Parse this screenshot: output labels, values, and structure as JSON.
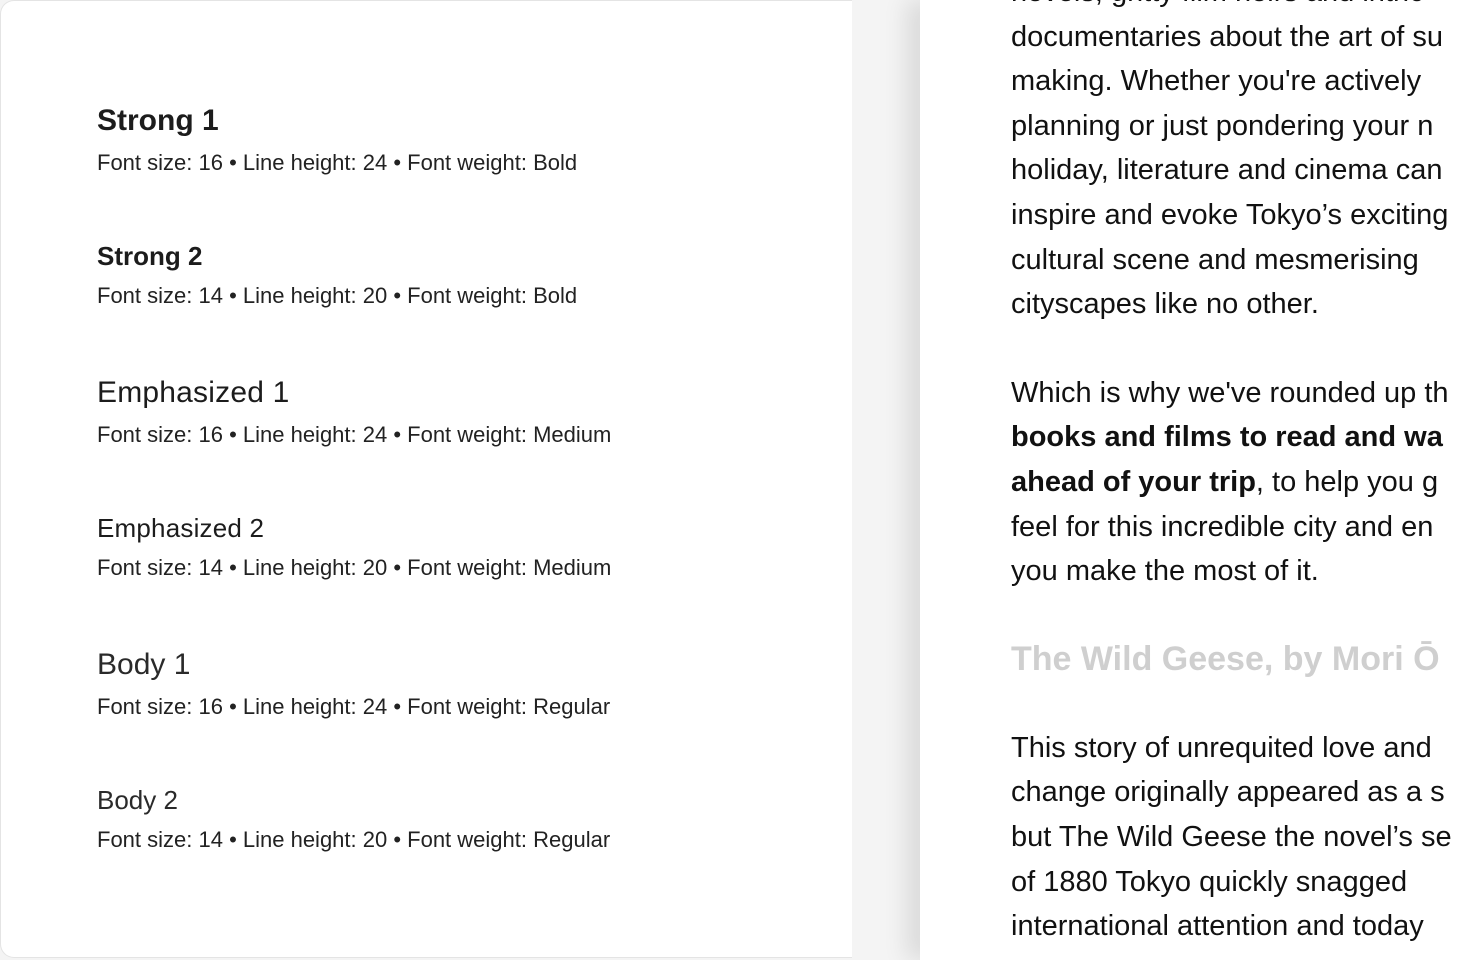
{
  "specimens": [
    {
      "name": "Strong 1",
      "meta": "Font size: 16 • Line height: 24 • Font weight: Bold"
    },
    {
      "name": "Strong 2",
      "meta": "Font size: 14 • Line height: 20 • Font weight: Bold"
    },
    {
      "name": "Emphasized 1",
      "meta": "Font size: 16 • Line height: 24 • Font weight: Medium"
    },
    {
      "name": "Emphasized 2",
      "meta": "Font size: 14 • Line height: 20 • Font weight: Medium"
    },
    {
      "name": "Body 1",
      "meta": "Font size: 16 • Line height: 24 • Font weight: Regular"
    },
    {
      "name": "Body 2",
      "meta": "Font size: 14 • Line height: 20 • Font weight: Regular"
    }
  ],
  "article": {
    "para1": [
      "novels, gritty film noirs and intric",
      "documentaries about the art of su",
      "making. Whether you're actively",
      "planning or just pondering your n",
      "holiday, literature and cinema can",
      "inspire and evoke Tokyo’s exciting",
      "cultural scene and mesmerising",
      "cityscapes like no other."
    ],
    "para2": {
      "l1": "Which is why we've rounded up th",
      "l2_bold": "books and films to read and wa",
      "l3_bold": "ahead of your trip",
      "l3_rest": ", to help you g",
      "l4": "feel for this incredible city and en",
      "l5": "you make the most of it."
    },
    "heading": "The Wild Geese, by Mori Ō",
    "para3": [
      "This story of unrequited love and",
      "change originally appeared as a s",
      "but The Wild Geese the novel’s se",
      "of 1880 Tokyo quickly snagged",
      "international attention and today"
    ]
  }
}
